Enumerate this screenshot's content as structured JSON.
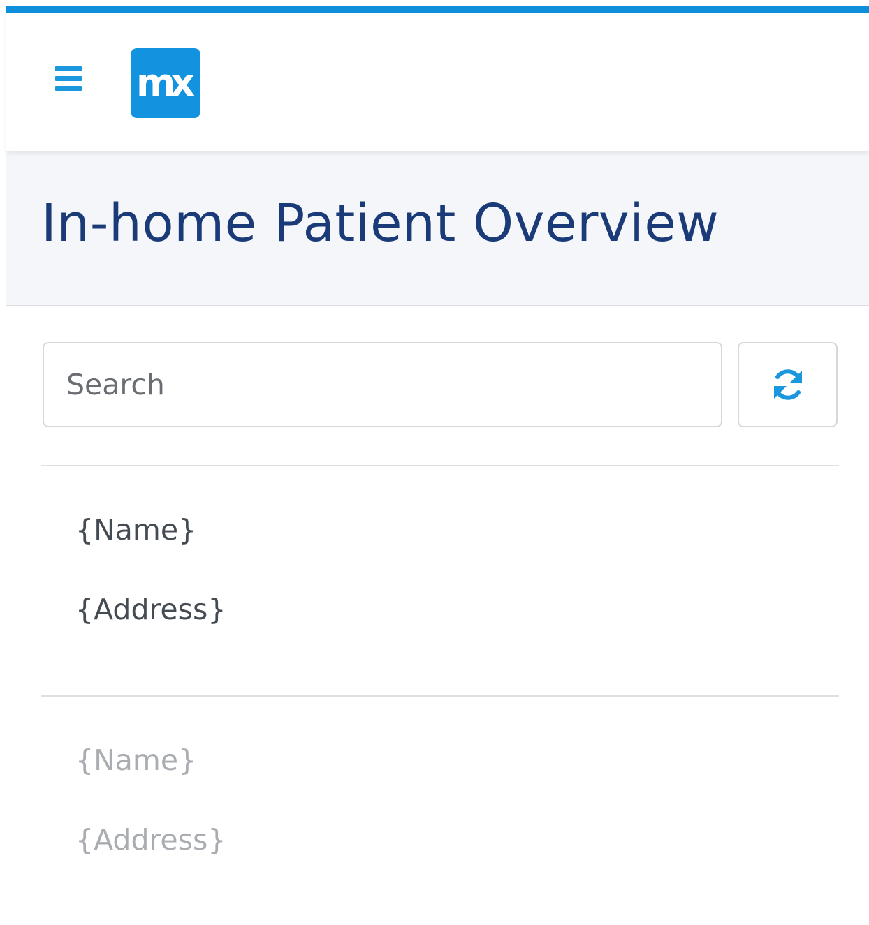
{
  "colors": {
    "accent": "#0e8fdc",
    "logo_bg": "#1392e0",
    "title": "#1b3b78",
    "header_band": "#f4f6f9",
    "refresh_icon": "#1a97dd"
  },
  "topbar": {
    "menu_icon": "hamburger-menu-icon",
    "logo_text": "mx"
  },
  "header": {
    "title": "In-home Patient Overview"
  },
  "search": {
    "placeholder": "Search",
    "value": ""
  },
  "refresh_button": {
    "icon": "refresh-icon"
  },
  "list": {
    "items": [
      {
        "name": "{Name}",
        "address": "{Address}"
      },
      {
        "name": "{Name}",
        "address": "{Address}"
      }
    ]
  }
}
